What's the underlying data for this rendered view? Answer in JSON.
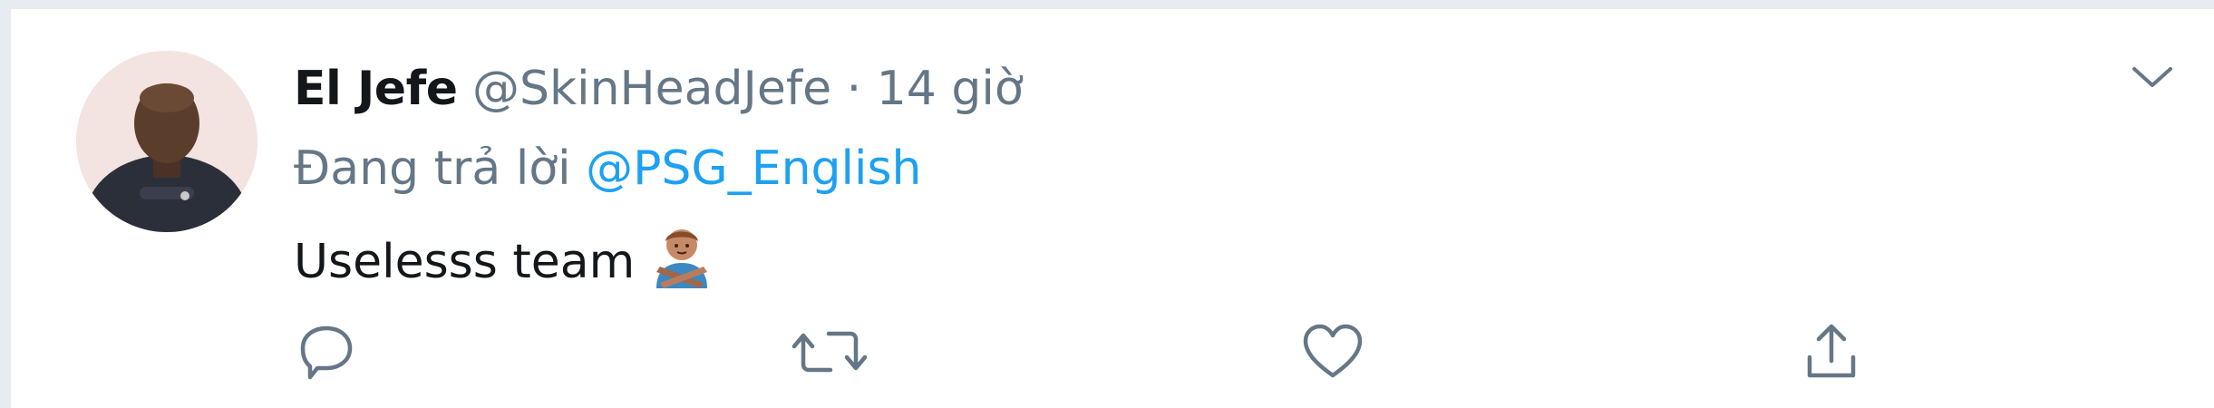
{
  "tweet": {
    "display_name": "El Jefe",
    "handle": "@SkinHeadJefe",
    "separator": "·",
    "time": "14 giờ",
    "replying_label": "Đang trả lời",
    "replying_to": "@PSG_English",
    "text": "Uselesss team",
    "emoji_icon": "person-gesturing-no-icon",
    "menu_icon": "chevron-down-icon"
  },
  "actions": [
    {
      "name": "reply",
      "icon": "comment-icon"
    },
    {
      "name": "retweet",
      "icon": "retweet-icon"
    },
    {
      "name": "like",
      "icon": "heart-icon"
    },
    {
      "name": "share",
      "icon": "share-icon"
    }
  ],
  "colors": {
    "name": "#14171a",
    "muted": "#657786",
    "link": "#1da1f2",
    "border": "#e6ecf0"
  }
}
